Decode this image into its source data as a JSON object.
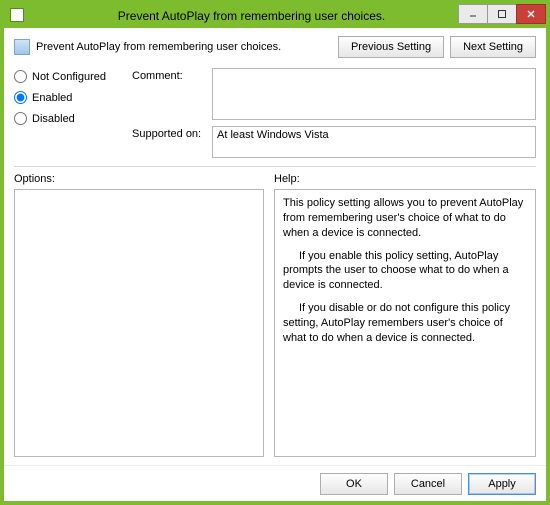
{
  "window": {
    "title": "Prevent AutoPlay from remembering user choices."
  },
  "header": {
    "policy_name": "Prevent AutoPlay from remembering user choices.",
    "prev_label": "Previous Setting",
    "next_label": "Next Setting"
  },
  "state": {
    "not_configured_label": "Not Configured",
    "enabled_label": "Enabled",
    "disabled_label": "Disabled",
    "selected": "enabled"
  },
  "fields": {
    "comment_label": "Comment:",
    "comment_value": "",
    "supported_label": "Supported on:",
    "supported_value": "At least Windows Vista"
  },
  "sections": {
    "options_label": "Options:",
    "help_label": "Help:"
  },
  "help": {
    "p1": "This policy setting allows you to prevent AutoPlay from remembering user's choice of what to do when a device is connected.",
    "p2": "If you enable this policy setting, AutoPlay prompts the user to choose what to do when a device is connected.",
    "p3": "If you disable or do not configure this policy setting, AutoPlay  remembers user's choice of what to do when a device is connected."
  },
  "buttons": {
    "ok": "OK",
    "cancel": "Cancel",
    "apply": "Apply"
  }
}
